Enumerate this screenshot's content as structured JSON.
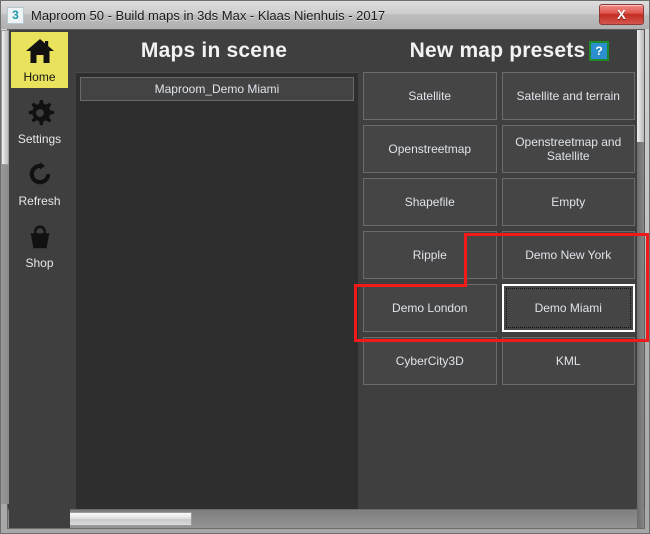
{
  "window": {
    "title": "Maproom 50 - Build maps in 3ds Max - Klaas Nienhuis - 2017",
    "app_icon_glyph": "3",
    "close_label": "X"
  },
  "sidebar": {
    "items": [
      {
        "label": "Home",
        "icon": "home-icon",
        "active": true
      },
      {
        "label": "Settings",
        "icon": "gear-icon",
        "active": false
      },
      {
        "label": "Refresh",
        "icon": "refresh-icon",
        "active": false
      },
      {
        "label": "Shop",
        "icon": "shop-bag-icon",
        "active": false
      }
    ]
  },
  "maps_panel": {
    "title": "Maps in scene",
    "items": [
      {
        "label": "Maproom_Demo Miami"
      }
    ]
  },
  "presets_panel": {
    "title": "New map presets",
    "help_label": "?",
    "buttons": [
      {
        "label": "Satellite",
        "focused": false
      },
      {
        "label": "Satellite and terrain",
        "focused": false
      },
      {
        "label": "Openstreetmap",
        "focused": false
      },
      {
        "label": "Openstreetmap and Satellite",
        "focused": false
      },
      {
        "label": "Shapefile",
        "focused": false
      },
      {
        "label": "Empty",
        "focused": false
      },
      {
        "label": "Ripple",
        "focused": false
      },
      {
        "label": "Demo New York",
        "focused": false
      },
      {
        "label": "Demo London",
        "focused": false
      },
      {
        "label": "Demo Miami",
        "focused": true
      },
      {
        "label": "CyberCity3D",
        "focused": false
      },
      {
        "label": "KML",
        "focused": false
      }
    ]
  },
  "colors": {
    "accent_yellow": "#e9e25c",
    "annotation_red": "#f01a1a",
    "help_blue": "#2b8fd0",
    "help_border_green": "#1f8a2a",
    "panel_dark": "#2e2e2e",
    "button_gray": "#454545"
  }
}
